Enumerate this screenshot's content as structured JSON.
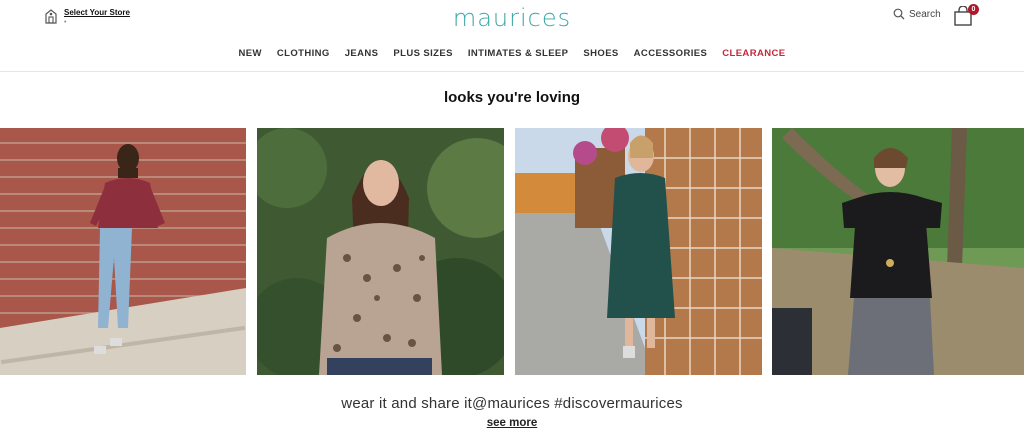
{
  "header": {
    "store": {
      "label": "Select Your Store",
      "sub": "•"
    },
    "logo": "maurices",
    "search_label": "Search",
    "cart_count": "0"
  },
  "nav": [
    {
      "label": "NEW"
    },
    {
      "label": "CLOTHING"
    },
    {
      "label": "JEANS"
    },
    {
      "label": "PLUS SIZES"
    },
    {
      "label": "INTIMATES & SLEEP"
    },
    {
      "label": "SHOES"
    },
    {
      "label": "ACCESSORIES"
    },
    {
      "label": "CLEARANCE"
    }
  ],
  "main": {
    "headline": "looks you're loving",
    "share_text": "wear it and share it@maurices #discovermaurices",
    "see_more": "see more"
  },
  "colors": {
    "brand": "#3ba7a8",
    "clearance": "#c3283c",
    "badge": "#b1162a"
  }
}
